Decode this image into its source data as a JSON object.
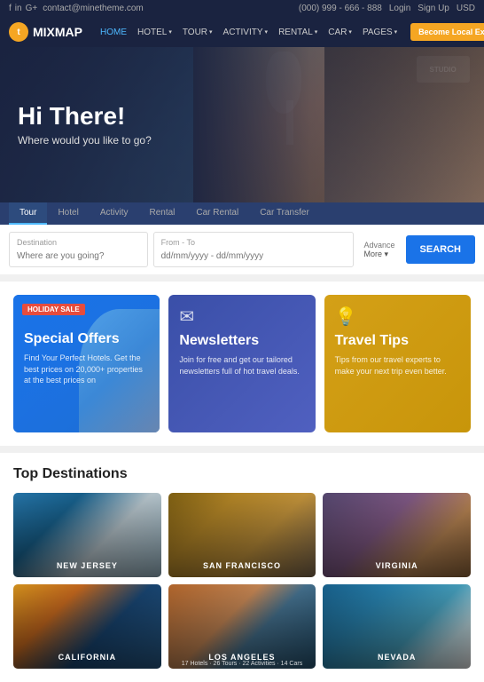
{
  "topbar": {
    "email": "contact@minetheme.com",
    "phone": "(000) 999 - 666 - 888",
    "login": "Login",
    "signup": "Sign Up",
    "currency": "USD",
    "social": [
      "f",
      "in",
      "G+"
    ]
  },
  "navbar": {
    "logo_letter": "t",
    "brand": "MIXMAP",
    "links": [
      {
        "label": "HOME",
        "active": true,
        "has_arrow": false
      },
      {
        "label": "HOTEL",
        "active": false,
        "has_arrow": true
      },
      {
        "label": "TOUR",
        "active": false,
        "has_arrow": true
      },
      {
        "label": "ACTIVITY",
        "active": false,
        "has_arrow": true
      },
      {
        "label": "RENTAL",
        "active": false,
        "has_arrow": true
      },
      {
        "label": "CAR",
        "active": false,
        "has_arrow": true
      },
      {
        "label": "PAGES",
        "active": false,
        "has_arrow": true
      }
    ],
    "cta": "Become Local Expert"
  },
  "hero": {
    "title": "Hi There!",
    "subtitle": "Where would you like to go?"
  },
  "search": {
    "tabs": [
      {
        "label": "Tour",
        "active": true
      },
      {
        "label": "Hotel",
        "active": false
      },
      {
        "label": "Activity",
        "active": false
      },
      {
        "label": "Rental",
        "active": false
      },
      {
        "label": "Car Rental",
        "active": false
      },
      {
        "label": "Car Transfer",
        "active": false
      }
    ],
    "destination_label": "Destination",
    "destination_placeholder": "Where are you going?",
    "date_label": "From - To",
    "date_placeholder": "dd/mm/yyyy - dd/mm/yyyy",
    "advance_label": "Advance",
    "advance_sub": "More ▾",
    "search_button": "SEARCH"
  },
  "cards": {
    "special": {
      "badge": "HOLIDAY SALE",
      "title": "Special Offers",
      "desc": "Find Your Perfect Hotels. Get the best prices on 20,000+ properties at the best prices on"
    },
    "newsletters": {
      "title": "Newsletters",
      "desc": "Join for free and get our tailored newsletters full of hot travel deals."
    },
    "tips": {
      "title": "Travel Tips",
      "desc": "Tips from our travel experts to make your next trip even better."
    }
  },
  "destinations": {
    "section_title": "Top Destinations",
    "items": [
      {
        "name": "NEW JERSEY",
        "bg_class": "bg-new-jersey",
        "meta": ""
      },
      {
        "name": "SAN FRANCISCO",
        "bg_class": "bg-san-francisco",
        "meta": ""
      },
      {
        "name": "VIRGINIA",
        "bg_class": "bg-virginia",
        "meta": ""
      },
      {
        "name": "CALIFORNIA",
        "bg_class": "bg-california",
        "meta": ""
      },
      {
        "name": "LOS ANGELES",
        "bg_class": "bg-los-angeles",
        "meta": "17 Hotels · 26 Tours · 22 Activities · 14 Cars"
      },
      {
        "name": "NEVADA",
        "bg_class": "bg-nevada",
        "meta": ""
      }
    ]
  }
}
